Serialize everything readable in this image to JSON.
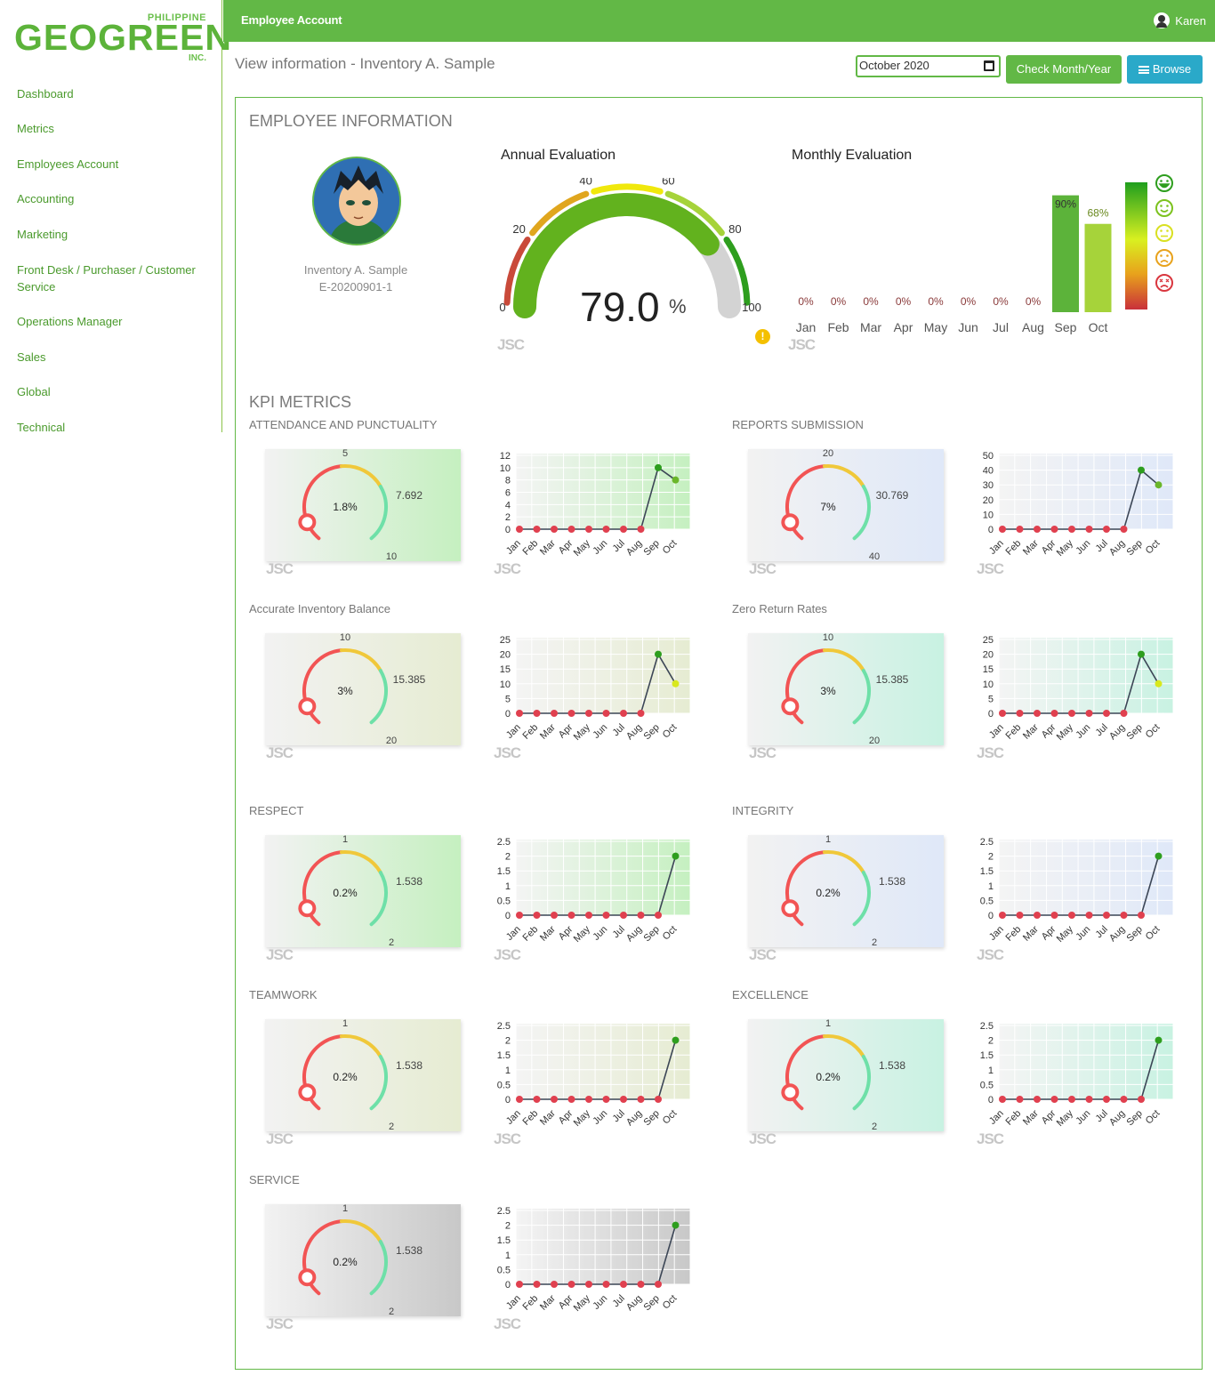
{
  "brand": {
    "top": "PHILIPPINE",
    "word": "GEOGREEN",
    "bottom": "INC."
  },
  "sidebar": {
    "items": [
      {
        "label": "Dashboard"
      },
      {
        "label": "Metrics"
      },
      {
        "label": "Employees Account"
      },
      {
        "label": "Accounting"
      },
      {
        "label": "Marketing"
      },
      {
        "label": "Front Desk / Purchaser / Customer Service"
      },
      {
        "label": "Operations Manager"
      },
      {
        "label": "Sales"
      },
      {
        "label": "Global"
      },
      {
        "label": "Technical"
      }
    ]
  },
  "topbar": {
    "title": "Employee Account",
    "user": "Karen"
  },
  "view": {
    "title": "View information - Inventory A. Sample",
    "month_value": "October 2020",
    "check_label": "Check Month/Year",
    "browse_label": "Browse"
  },
  "employee": {
    "heading": "EMPLOYEE INFORMATION",
    "name": "Inventory A. Sample",
    "id": "E-20200901-1"
  },
  "annual": {
    "title": "Annual Evaluation",
    "value": "79.0",
    "unit": "%",
    "level": 79.0,
    "scale_labels": [
      "0",
      "20",
      "40",
      "60",
      "80",
      "100"
    ]
  },
  "monthly": {
    "title": "Monthly Evaluation",
    "months": [
      "Jan",
      "Feb",
      "Mar",
      "Apr",
      "May",
      "Jun",
      "Jul",
      "Aug",
      "Sep",
      "Oct"
    ],
    "labels": [
      "0%",
      "0%",
      "0%",
      "0%",
      "0%",
      "0%",
      "0%",
      "0%",
      "90%",
      "68%"
    ],
    "values": [
      0,
      0,
      0,
      0,
      0,
      0,
      0,
      0,
      90,
      68
    ],
    "bar_colors": [
      "#5cb33a",
      "#a6d33a"
    ],
    "faces": [
      {
        "icon": "laugh-face-icon",
        "color": "#2e9e1e"
      },
      {
        "icon": "smile-face-icon",
        "color": "#7cc21e"
      },
      {
        "icon": "neutral-face-icon",
        "color": "#d9e021"
      },
      {
        "icon": "frown-face-icon",
        "color": "#e8a21c"
      },
      {
        "icon": "dizzy-face-icon",
        "color": "#d9363e"
      }
    ]
  },
  "kpi": {
    "heading": "KPI METRICS",
    "months": [
      "Jan",
      "Feb",
      "Mar",
      "Apr",
      "May",
      "Jun",
      "Jul",
      "Aug",
      "Sep",
      "Oct"
    ],
    "metrics": [
      {
        "title": "ATTENDANCE AND PUNCTUALITY",
        "percent": "1.8%",
        "top": "5",
        "right": "7.692",
        "bottom": "10",
        "yticks": [
          "12",
          "10",
          "8",
          "6",
          "4",
          "2",
          "0"
        ],
        "ymax": 12,
        "values": [
          0,
          0,
          0,
          0,
          0,
          0,
          0,
          0,
          10,
          8
        ],
        "last_color": "#6ab62a",
        "bg": "#c5f0c0"
      },
      {
        "title": "REPORTS SUBMISSION",
        "percent": "7%",
        "top": "20",
        "right": "30.769",
        "bottom": "40",
        "yticks": [
          "50",
          "40",
          "30",
          "20",
          "10",
          "0"
        ],
        "ymax": 50,
        "values": [
          0,
          0,
          0,
          0,
          0,
          0,
          0,
          0,
          40,
          30
        ],
        "last_color": "#6ab62a",
        "bg": "#dfe8f8"
      },
      {
        "title": "Accurate Inventory Balance",
        "percent": "3%",
        "top": "10",
        "right": "15.385",
        "bottom": "20",
        "yticks": [
          "25",
          "20",
          "15",
          "10",
          "5",
          "0"
        ],
        "ymax": 25,
        "values": [
          0,
          0,
          0,
          0,
          0,
          0,
          0,
          0,
          20,
          10
        ],
        "last_color": "#d8e81e",
        "bg": "#e6ecd2"
      },
      {
        "title": "Zero Return Rates",
        "percent": "3%",
        "top": "10",
        "right": "15.385",
        "bottom": "20",
        "yticks": [
          "25",
          "20",
          "15",
          "10",
          "5",
          "0"
        ],
        "ymax": 25,
        "values": [
          0,
          0,
          0,
          0,
          0,
          0,
          0,
          0,
          20,
          10
        ],
        "last_color": "#d8e81e",
        "bg": "#c8f2e2"
      },
      {
        "title": "RESPECT",
        "percent": "0.2%",
        "top": "1",
        "right": "1.538",
        "bottom": "2",
        "yticks": [
          "2.5",
          "2",
          "1.5",
          "1",
          "0.5",
          "0"
        ],
        "ymax": 2.5,
        "values": [
          0,
          0,
          0,
          0,
          0,
          0,
          0,
          0,
          0,
          2
        ],
        "last_color": "#2e9e1e",
        "bg": "#c5f0c0"
      },
      {
        "title": "INTEGRITY",
        "percent": "0.2%",
        "top": "1",
        "right": "1.538",
        "bottom": "2",
        "yticks": [
          "2.5",
          "2",
          "1.5",
          "1",
          "0.5",
          "0"
        ],
        "ymax": 2.5,
        "values": [
          0,
          0,
          0,
          0,
          0,
          0,
          0,
          0,
          0,
          2
        ],
        "last_color": "#2e9e1e",
        "bg": "#dfe8f8"
      },
      {
        "title": "TEAMWORK",
        "percent": "0.2%",
        "top": "1",
        "right": "1.538",
        "bottom": "2",
        "yticks": [
          "2.5",
          "2",
          "1.5",
          "1",
          "0.5",
          "0"
        ],
        "ymax": 2.5,
        "values": [
          0,
          0,
          0,
          0,
          0,
          0,
          0,
          0,
          0,
          2
        ],
        "last_color": "#2e9e1e",
        "bg": "#e6ecd2"
      },
      {
        "title": "EXCELLENCE",
        "percent": "0.2%",
        "top": "1",
        "right": "1.538",
        "bottom": "2",
        "yticks": [
          "2.5",
          "2",
          "1.5",
          "1",
          "0.5",
          "0"
        ],
        "ymax": 2.5,
        "values": [
          0,
          0,
          0,
          0,
          0,
          0,
          0,
          0,
          0,
          2
        ],
        "last_color": "#2e9e1e",
        "bg": "#c8f2e2"
      },
      {
        "title": "SERVICE",
        "percent": "0.2%",
        "top": "1",
        "right": "1.538",
        "bottom": "2",
        "yticks": [
          "2.5",
          "2",
          "1.5",
          "1",
          "0.5",
          "0"
        ],
        "ymax": 2.5,
        "values": [
          0,
          0,
          0,
          0,
          0,
          0,
          0,
          0,
          0,
          2
        ],
        "last_color": "#2e9e1e",
        "bg": "#c8c8c8"
      }
    ]
  },
  "watermark": "JSC"
}
